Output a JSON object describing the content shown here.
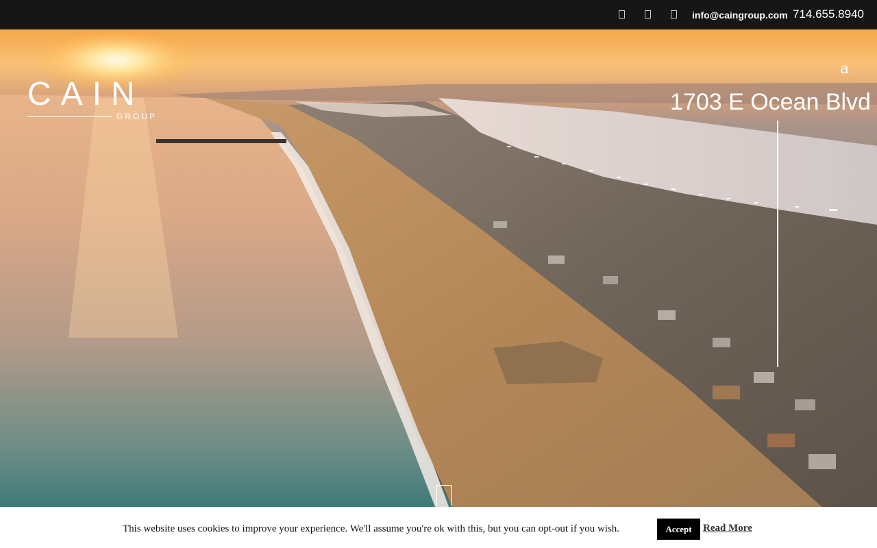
{
  "topbar": {
    "icons": [
      "social-icon-1",
      "social-icon-2",
      "social-icon-3"
    ],
    "email": "info@caingroup.com",
    "phone": "714.655.8940"
  },
  "logo": {
    "main": "CAIN",
    "sub": "GROUP"
  },
  "hero": {
    "menu_glyph": "a",
    "address": "1703 E Ocean Blvd"
  },
  "cookie": {
    "text": "This website uses cookies to improve your experience. We'll assume you're ok with this, but you can opt-out if you wish.",
    "accept_label": "Accept",
    "read_more_label": "Read More"
  },
  "colors": {
    "topbar_bg": "#161616",
    "accent_white": "#ffffff",
    "accept_bg": "#000000"
  }
}
